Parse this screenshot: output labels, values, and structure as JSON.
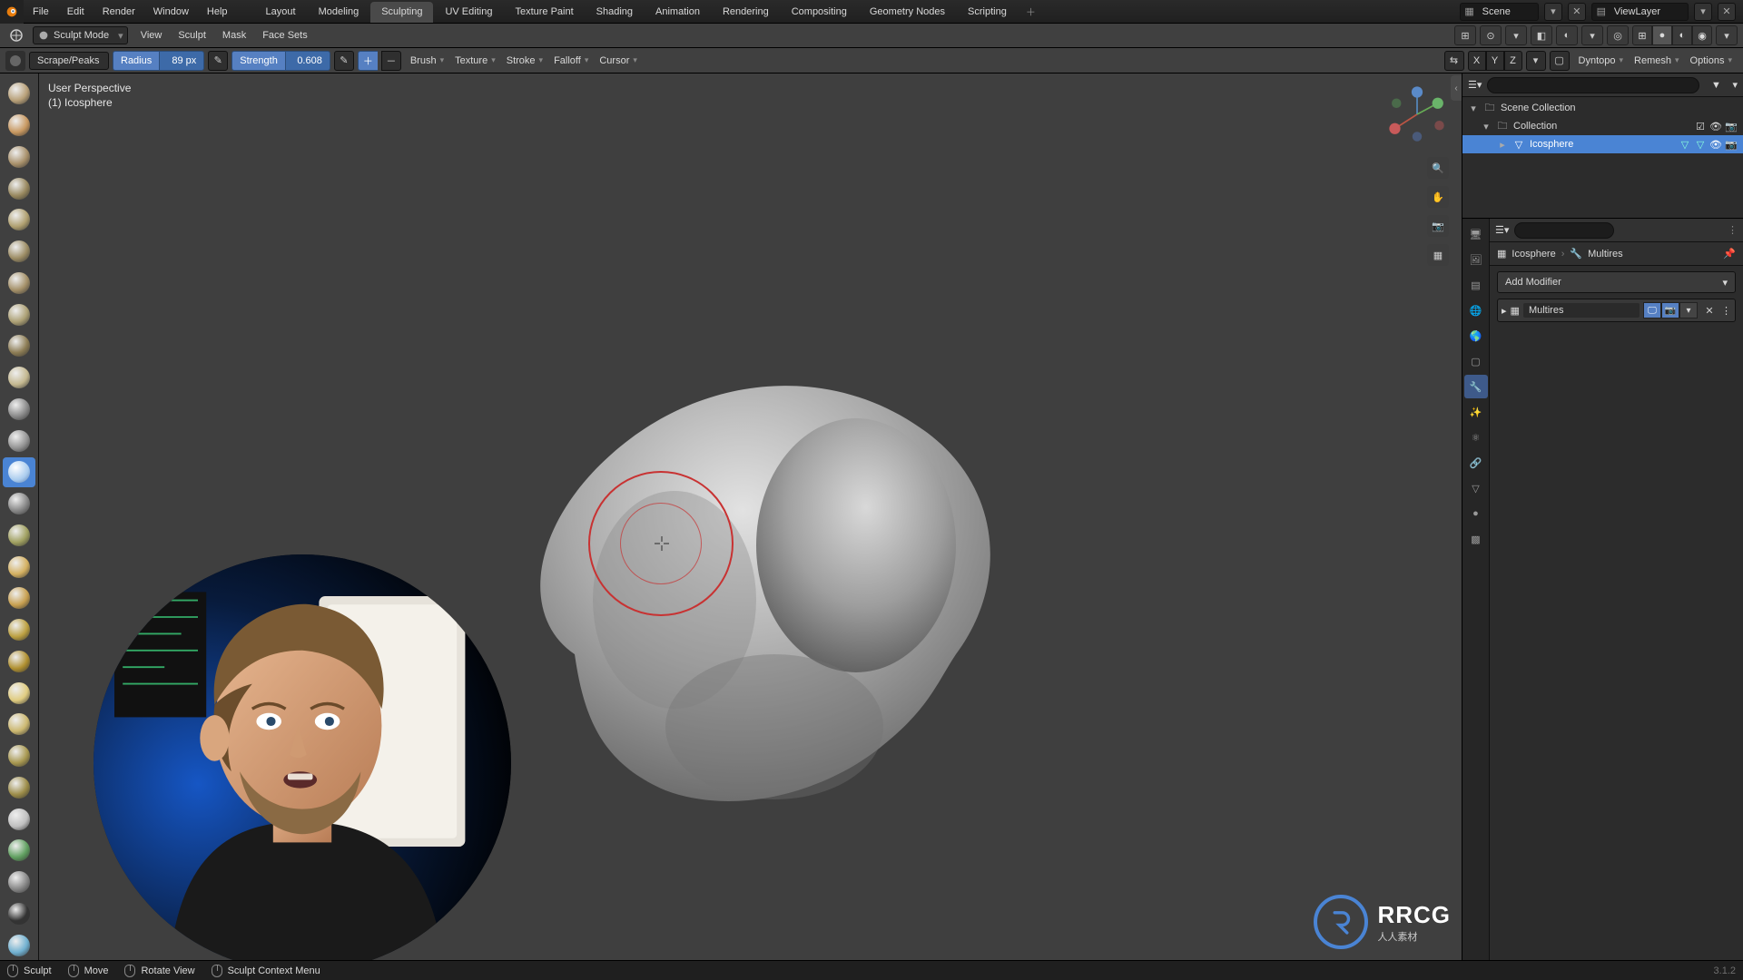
{
  "menus": [
    "File",
    "Edit",
    "Render",
    "Window",
    "Help"
  ],
  "workspaces": [
    "Layout",
    "Modeling",
    "Sculpting",
    "UV Editing",
    "Texture Paint",
    "Shading",
    "Animation",
    "Rendering",
    "Compositing",
    "Geometry Nodes",
    "Scripting"
  ],
  "active_workspace": "Sculpting",
  "scene_name": "Scene",
  "view_layer": "ViewLayer",
  "mode": "Sculpt Mode",
  "mode_menus": [
    "View",
    "Sculpt",
    "Mask",
    "Face Sets"
  ],
  "brush_name": "Scrape/Peaks",
  "radius_label": "Radius",
  "radius_value": "89 px",
  "strength_label": "Strength",
  "strength_value": "0.608",
  "tool_dropdowns": [
    "Brush",
    "Texture",
    "Stroke",
    "Falloff",
    "Cursor"
  ],
  "symmetry_axes": [
    "X",
    "Y",
    "Z"
  ],
  "right_dropdowns": [
    "Dyntopo",
    "Remesh",
    "Options"
  ],
  "viewport_info_line1": "User Perspective",
  "viewport_info_line2": "(1) Icosphere",
  "side_icons": [
    "zoom-icon",
    "pan-icon",
    "camera-icon",
    "perspective-icon"
  ],
  "outliner": {
    "root": "Scene Collection",
    "collection": "Collection",
    "object": "Icosphere"
  },
  "breadcrumb": {
    "object": "Icosphere",
    "modifier": "Multires"
  },
  "add_modifier": "Add Modifier",
  "modifier_name": "Multires",
  "status_items": [
    {
      "icon": "mouse-left",
      "label": "Sculpt"
    },
    {
      "icon": "mouse-middle",
      "label": "Move"
    },
    {
      "icon": "mouse-middle",
      "label": "Rotate View"
    },
    {
      "icon": "mouse-right",
      "label": "Sculpt Context Menu"
    }
  ],
  "version": "3.1.2",
  "watermark": {
    "big": "RRCG",
    "sub": "人人素材"
  },
  "tools": [
    "draw",
    "draw-sharp",
    "clay",
    "clay-strips",
    "clay-thumb",
    "layer",
    "inflate",
    "blob",
    "crease",
    "smooth",
    "flatten",
    "fill",
    "scrape",
    "multi-plane",
    "pinch",
    "grab",
    "elastic",
    "snake-hook",
    "thumb",
    "pose",
    "nudge",
    "rotate",
    "slide",
    "boundary",
    "cloth",
    "simplify",
    "mask",
    "draw-face-sets"
  ],
  "active_tool_index": 12,
  "prop_tabs": [
    "render",
    "output",
    "view-layer",
    "scene",
    "world",
    "object",
    "modifier",
    "particles",
    "physics",
    "constraints",
    "data",
    "material",
    "texture"
  ],
  "active_prop_tab": 6
}
